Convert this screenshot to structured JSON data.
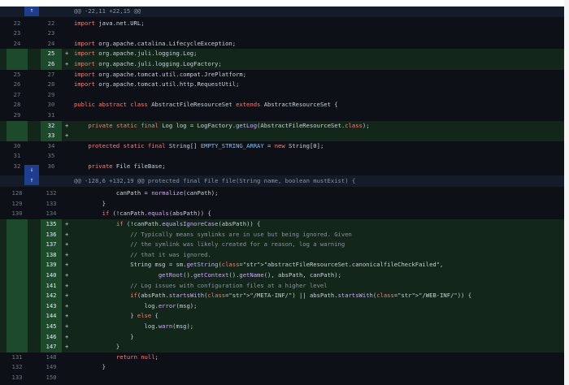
{
  "diff": {
    "hunks": [
      {
        "header": "@@ -22,11 +22,15 @@",
        "expand_icons": [
          "expand-up-icon"
        ]
      },
      {
        "header": "@@ -128,6 +132,19 @@ protected final File file(String name, boolean mustExist) {",
        "expand_icons": [
          "expand-down-icon",
          "expand-up-icon"
        ]
      }
    ],
    "lines": [
      {
        "old": "22",
        "new": "22",
        "type": "context",
        "text": "import java.net.URL;"
      },
      {
        "old": "23",
        "new": "23",
        "type": "context",
        "text": ""
      },
      {
        "old": "24",
        "new": "24",
        "type": "context",
        "text": "import org.apache.catalina.LifecycleException;"
      },
      {
        "old": "",
        "new": "25",
        "type": "add",
        "text": "import org.apache.juli.logging.Log;"
      },
      {
        "old": "",
        "new": "26",
        "type": "add",
        "text": "import org.apache.juli.logging.LogFactory;"
      },
      {
        "old": "25",
        "new": "27",
        "type": "context",
        "text": "import org.apache.tomcat.util.compat.JrePlatform;"
      },
      {
        "old": "26",
        "new": "28",
        "type": "context",
        "text": "import org.apache.tomcat.util.http.RequestUtil;"
      },
      {
        "old": "27",
        "new": "29",
        "type": "context",
        "text": ""
      },
      {
        "old": "28",
        "new": "30",
        "type": "context",
        "text": "public abstract class AbstractFileResourceSet extends AbstractResourceSet {"
      },
      {
        "old": "29",
        "new": "31",
        "type": "context",
        "text": ""
      },
      {
        "old": "",
        "new": "32",
        "type": "add",
        "text": "    private static final Log log = LogFactory.getLog(AbstractFileResourceSet.class);"
      },
      {
        "old": "",
        "new": "33",
        "type": "add",
        "text": ""
      },
      {
        "old": "30",
        "new": "34",
        "type": "context",
        "text": "    protected static final String[] EMPTY_STRING_ARRAY = new String[0];"
      },
      {
        "old": "31",
        "new": "35",
        "type": "context",
        "text": ""
      },
      {
        "old": "32",
        "new": "36",
        "type": "context",
        "text": "    private File fileBase;"
      },
      {
        "old": "128",
        "new": "132",
        "type": "context",
        "text": "            canPath = normalize(canPath);"
      },
      {
        "old": "129",
        "new": "133",
        "type": "context",
        "text": "        }"
      },
      {
        "old": "130",
        "new": "134",
        "type": "context",
        "text": "        if (!canPath.equals(absPath)) {"
      },
      {
        "old": "",
        "new": "135",
        "type": "add",
        "text": "            if (!canPath.equalsIgnoreCase(absPath)) {"
      },
      {
        "old": "",
        "new": "136",
        "type": "add",
        "text": "                // Typically means symlinks are in use but being ignored. Given"
      },
      {
        "old": "",
        "new": "137",
        "type": "add",
        "text": "                // the symlink was likely created for a reason, log a warning"
      },
      {
        "old": "",
        "new": "138",
        "type": "add",
        "text": "                // that it was ignored."
      },
      {
        "old": "",
        "new": "139",
        "type": "add",
        "text": "                String msg = sm.getString(\"abstractFileResourceSet.canonicalfileCheckFailed\","
      },
      {
        "old": "",
        "new": "140",
        "type": "add",
        "text": "                        getRoot().getContext().getName(), absPath, canPath);"
      },
      {
        "old": "",
        "new": "141",
        "type": "add",
        "text": "                // Log issues with configuration files at a higher level"
      },
      {
        "old": "",
        "new": "142",
        "type": "add",
        "text": "                if(absPath.startsWith(\"/META-INF/\") || absPath.startsWith(\"/WEB-INF/\")) {"
      },
      {
        "old": "",
        "new": "143",
        "type": "add",
        "text": "                    log.error(msg);"
      },
      {
        "old": "",
        "new": "144",
        "type": "add",
        "text": "                } else {"
      },
      {
        "old": "",
        "new": "145",
        "type": "add",
        "text": "                    log.warn(msg);"
      },
      {
        "old": "",
        "new": "146",
        "type": "add",
        "text": "                }"
      },
      {
        "old": "",
        "new": "147",
        "type": "add",
        "text": "            }"
      },
      {
        "old": "131",
        "new": "148",
        "type": "context",
        "text": "            return null;"
      },
      {
        "old": "132",
        "new": "149",
        "type": "context",
        "text": "        }"
      },
      {
        "old": "133",
        "new": "150",
        "type": "context",
        "text": ""
      }
    ]
  }
}
